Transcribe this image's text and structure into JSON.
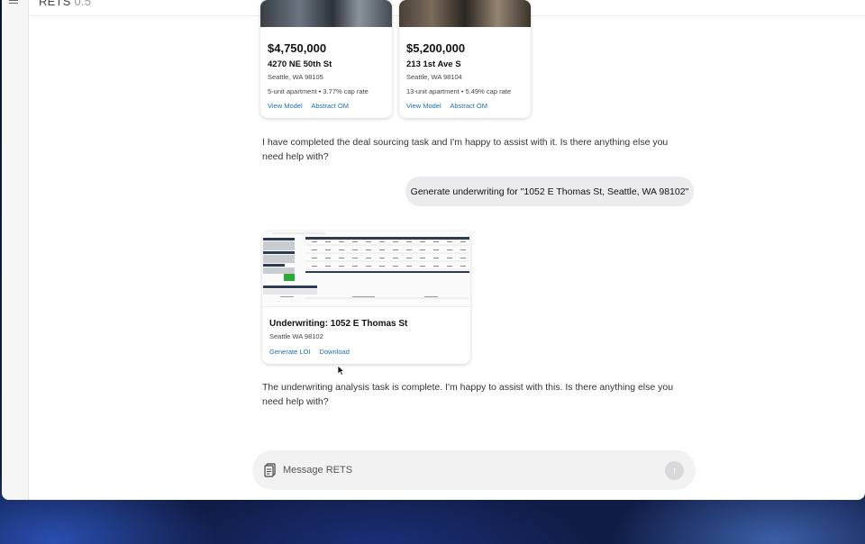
{
  "app": {
    "title": "RETS",
    "version": "0.5"
  },
  "properties": [
    {
      "price": "$4,750,000",
      "address": "4270 NE 50th St",
      "city": "Seattle, WA 98105",
      "details": "5-unit apartment • 3.77% cap rate",
      "links": [
        "View Model",
        "Abstract OM"
      ]
    },
    {
      "price": "$5,200,000",
      "address": "213 1st Ave S",
      "city": "Seattle, WA 98104",
      "details": "13-unit apartment • 5.49% cap rate",
      "links": [
        "View Model",
        "Abstract OM"
      ]
    }
  ],
  "messages": {
    "assistant_1": "I have completed the deal sourcing task and I'm happy to assist with it. Is there anything else you need help with?",
    "user_1": "Generate underwriting for \"1052 E Thomas St, Seattle, WA 98102\"",
    "assistant_2": "The underwriting analysis task is complete. I'm happy to assist with this. Is there anything else you need help with?"
  },
  "underwriting_card": {
    "title": "Underwriting: 1052 E Thomas St",
    "subtitle": "Seattle WA 98102",
    "links": [
      "Generate LOI",
      "Download"
    ]
  },
  "composer": {
    "placeholder": "Message RETS",
    "send_icon": "up-arrow-icon",
    "attach_icon": "document-icon"
  },
  "colors": {
    "link": "#1a6fb5",
    "user_bubble": "#ececee",
    "composer_bg": "#f2f2f3"
  }
}
